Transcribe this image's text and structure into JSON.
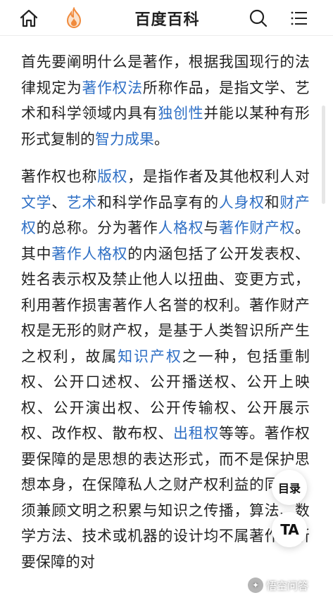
{
  "header": {
    "title": "百度百科",
    "icons": [
      "home-icon",
      "flame-icon",
      "search-icon",
      "menu-icon"
    ]
  },
  "article": {
    "p1": {
      "t1": "首先要阐明什么是著作，根据我国现行的法律规定为",
      "l1": "著作权法",
      "t2": "所称作品，是指文学、艺术和科学领域内具有",
      "l2": "独创性",
      "t3": "并能以某种有形形式复制的",
      "l3": "智力成果",
      "t4": "。"
    },
    "p2": {
      "t1": "著作权也称",
      "l1": "版权",
      "t2": "，是指作者及其他权利人对",
      "l2": "文学",
      "t3": "、",
      "l3": "艺术",
      "t4": "和科学作品享有的",
      "l4": "人身权",
      "t5": "和",
      "l5": "财产权",
      "t6": "的总称。分为著作",
      "l6": "人格权",
      "t7": "与",
      "l7": "著作财产权",
      "t8": "。其中",
      "l8": "著作人格权",
      "t9": "的内涵包括了公开发表权、姓名表示权及禁止他人以扭曲、变更方式，利用著作损害著作人名誉的权利。著作财产权是无形的财产权，是基于人类智识所产生之权利，故属",
      "l9": "知识产权",
      "t10": "之一种，包括重制权、公开口述权、公开播送权、公开上映权、公开演出权、公开传输权、公开展示权、改作权、散布权、",
      "l10": "出租权",
      "t11": "等等。著作权要保障的是思想的表达形式，而不是保护思想本身，在保障私人之财产权利益的同时，须兼顾文明之积累与知识之传播，算法、数学方法、技术或机器的设计均不属著作权所要保障的对"
    }
  },
  "floating": {
    "toc_label": "目录",
    "text_size_label": "TA"
  },
  "watermark": {
    "text": "悟空问答"
  },
  "colors": {
    "link": "#2e6fc5",
    "text": "#222222",
    "flame": "#f08a3c"
  }
}
